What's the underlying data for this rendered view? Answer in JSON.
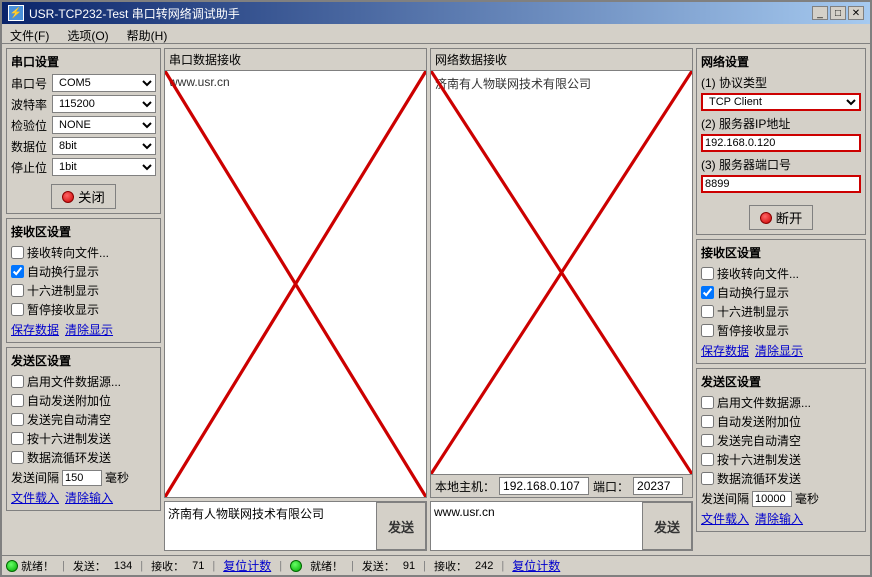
{
  "window": {
    "title": "USR-TCP232-Test 串口转网络调试助手",
    "icon": "⚡"
  },
  "menu": {
    "items": [
      "文件(F)",
      "选项(O)",
      "帮助(H)"
    ]
  },
  "serial_settings": {
    "title": "串口设置",
    "port_label": "串口号",
    "port_value": "COM5",
    "baud_label": "波特率",
    "baud_value": "115200",
    "check_label": "检验位",
    "check_value": "NONE",
    "data_label": "数据位",
    "data_value": "8bit",
    "stop_label": "停止位",
    "stop_value": "1bit",
    "close_btn": "关闭"
  },
  "serial_receive": {
    "title": "接收区设置",
    "checkboxes": [
      {
        "label": "接收转向文件...",
        "checked": false
      },
      {
        "label": "自动换行显示",
        "checked": true
      },
      {
        "label": "十六进制显示",
        "checked": false
      },
      {
        "label": "暂停接收显示",
        "checked": false
      }
    ],
    "save_link": "保存数据",
    "clear_link": "清除显示"
  },
  "serial_send": {
    "title": "发送区设置",
    "checkboxes": [
      {
        "label": "启用文件数据源...",
        "checked": false
      },
      {
        "label": "自动发送附加位",
        "checked": false
      },
      {
        "label": "发送完自动清空",
        "checked": false
      },
      {
        "label": "按十六进制发送",
        "checked": false
      },
      {
        "label": "数据流循环发送",
        "checked": false
      }
    ],
    "interval_label": "发送间隔",
    "interval_value": "150",
    "interval_unit": "毫秒",
    "file_input": "文件载入",
    "clear_input": "清除输入"
  },
  "serial_data_panel": {
    "title": "串口数据接收",
    "content": "www.usr.cn"
  },
  "network_data_panel": {
    "title": "网络数据接收",
    "content": "济南有人物联网技术有限公司",
    "local_addr_label": "本地主机：",
    "local_addr": "192.168.0.107",
    "port_label": "端口：",
    "port_value": "20237"
  },
  "network_settings": {
    "title": "网络设置",
    "protocol_label": "(1) 协议类型",
    "protocol_value": "TCP Client",
    "server_ip_label": "(2) 服务器IP地址",
    "server_ip": "192.168.0.120",
    "server_port_label": "(3) 服务器端口号",
    "server_port": "8899",
    "open_btn": "断开"
  },
  "network_receive": {
    "title": "接收区设置",
    "checkboxes": [
      {
        "label": "接收转向文件...",
        "checked": false
      },
      {
        "label": "自动换行显示",
        "checked": true
      },
      {
        "label": "十六进制显示",
        "checked": false
      },
      {
        "label": "暂停接收显示",
        "checked": false
      }
    ],
    "save_link": "保存数据",
    "clear_link": "清除显示"
  },
  "network_send": {
    "title": "发送区设置",
    "checkboxes": [
      {
        "label": "启用文件数据源...",
        "checked": false
      },
      {
        "label": "自动发送附加位",
        "checked": false
      },
      {
        "label": "发送完自动清空",
        "checked": false
      },
      {
        "label": "按十六进制发送",
        "checked": false
      },
      {
        "label": "数据流循环发送",
        "checked": false
      }
    ],
    "interval_label": "发送间隔",
    "interval_value": "10000",
    "interval_unit": "毫秒",
    "file_input": "文件载入",
    "clear_input": "清除输入"
  },
  "serial_send_input": "济南有人物联网技术有限公司",
  "network_send_input": "www.usr.cn",
  "send_btn_label": "发送",
  "status_bar": {
    "status_label": "就绪！",
    "serial_send_label": "发送：",
    "serial_send_value": "134",
    "serial_recv_label": "接收：",
    "serial_recv_value": "71",
    "reset_label": "复位计数",
    "net_status_label": "就绪！",
    "net_send_label": "发送：",
    "net_send_value": "91",
    "net_recv_label": "接收：",
    "net_recv_value": "242",
    "net_reset_label": "复位计数"
  }
}
